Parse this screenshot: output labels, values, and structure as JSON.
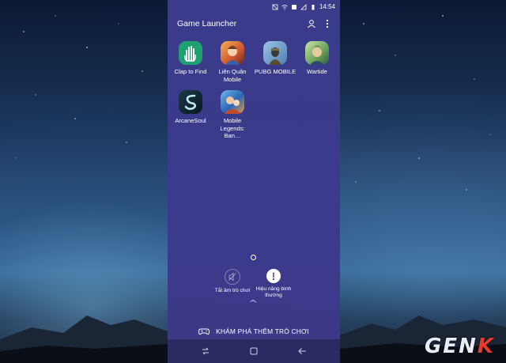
{
  "status_bar": {
    "time": "14:54"
  },
  "app_bar": {
    "title": "Game Launcher"
  },
  "games": [
    {
      "label": "Clap to Find",
      "icon": "clap-hand-icon"
    },
    {
      "label": "Liên Quân Mobile",
      "icon": "lien-quan-icon"
    },
    {
      "label": "PUBG MOBILE",
      "icon": "pubg-icon"
    },
    {
      "label": "Wartide",
      "icon": "wartide-icon"
    },
    {
      "label": "ArcaneSoul",
      "icon": "arcanesoul-icon"
    },
    {
      "label": "Mobile Legends: Ban…",
      "icon": "mobile-legends-icon"
    }
  ],
  "quick_actions": {
    "mute": {
      "label": "Tắt âm trò chơi",
      "icon": "mute-icon"
    },
    "performance": {
      "label": "Hiệu năng bình thường",
      "icon": "performance-icon"
    }
  },
  "discover": {
    "label": "KHÁM PHÁ THÊM TRÒ CHƠI",
    "icon": "gamepad-icon"
  },
  "watermark": {
    "brand_left": "GEN",
    "brand_right": "K"
  },
  "colors": {
    "phone_bg": "#3a3b8a",
    "navbar": "#2b2b63",
    "accent": "#8fb6ff",
    "brand_red": "#e63a2e"
  }
}
